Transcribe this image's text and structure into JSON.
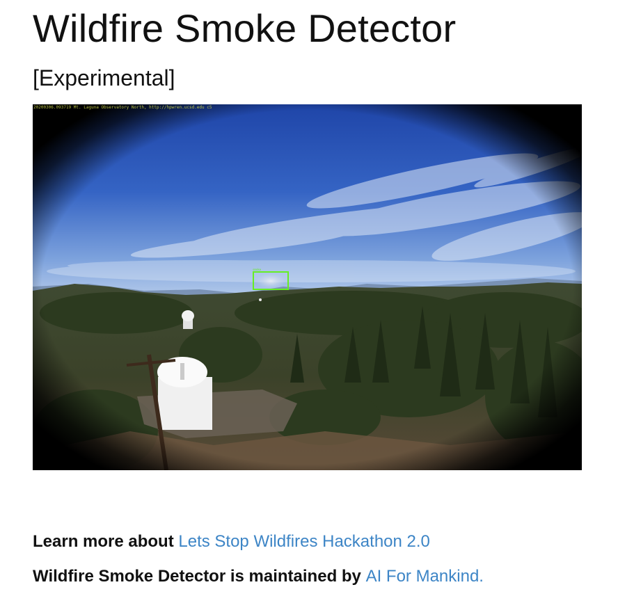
{
  "page": {
    "title": "Wildfire Smoke Detector",
    "subtitle": "[Experimental]"
  },
  "camera": {
    "overlay_caption": "20200306.093719  Mt. Laguna Observatory North,  http://hpwren.ucsd.edu  c5",
    "detection_tag": "smoke"
  },
  "learn_more": {
    "lead": "Learn more about ",
    "link": "Lets Stop Wildfires Hackathon 2.0"
  },
  "maintained": {
    "lead": "Wildfire Smoke Detector is maintained by ",
    "link": "AI For Mankind."
  },
  "colors": {
    "link": "#3d85c6",
    "detection_box": "#66ee22",
    "sky_top": "#2a4fb0",
    "sky_horizon": "#9cbbe6",
    "forest": "#3a4a2a"
  }
}
